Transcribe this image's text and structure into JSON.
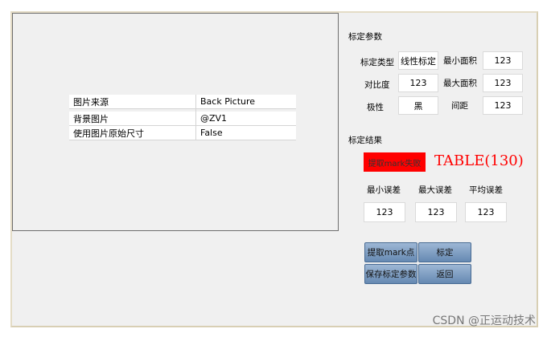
{
  "properties": [
    {
      "key": "图片来源",
      "value": "Back Picture"
    },
    {
      "key": "背景图片",
      "value": "@ZV1"
    },
    {
      "key": "使用图片原始尺寸",
      "value": "False"
    }
  ],
  "params": {
    "section_title": "标定参数",
    "calib_type_label": "标定类型",
    "calib_type_value": "线性标定",
    "min_area_label": "最小面积",
    "min_area_value": "123",
    "contrast_label": "对比度",
    "contrast_value": "123",
    "max_area_label": "最大面积",
    "max_area_value": "123",
    "polarity_label": "极性",
    "polarity_value": "黑",
    "spacing_label": "间距",
    "spacing_value": "123"
  },
  "results": {
    "section_title": "标定结果",
    "status_text": "提取mark失败",
    "status_color": "#ff0000",
    "table_code": "TABLE(130)",
    "min_error_label": "最小误差",
    "max_error_label": "最大误差",
    "avg_error_label": "平均误差",
    "min_error_value": "123",
    "max_error_value": "123",
    "avg_error_value": "123"
  },
  "buttons": {
    "extract_mark": "提取mark点",
    "calibrate": "标定",
    "save_params": "保存标定参数",
    "back": "返回"
  },
  "watermark": "CSDN @正运动技术"
}
